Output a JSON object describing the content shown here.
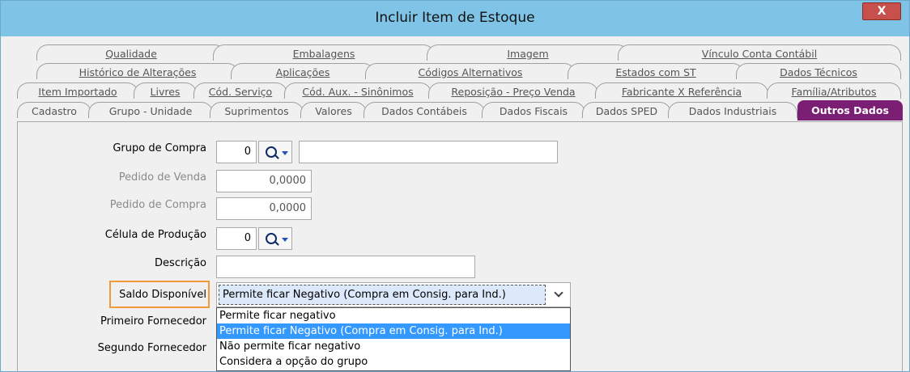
{
  "window": {
    "title": "Incluir Item de Estoque",
    "close_label": "X"
  },
  "tabs": {
    "row1": [
      "Qualidade",
      "Embalagens",
      "Imagem",
      "Vínculo Conta Contábil"
    ],
    "row2": [
      "Histórico de Alterações",
      "Aplicações",
      "Códigos Alternativos",
      "Estados com ST",
      "Dados Técnicos"
    ],
    "row3": [
      "Item Importado",
      "Livres",
      "Cód. Serviço",
      "Cód. Aux. - Sinônimos",
      "Reposição - Preço Venda",
      "Fabricante X Referência",
      "Família/Atributos"
    ],
    "row4": [
      "Cadastro",
      "Grupo - Unidade",
      "Suprimentos",
      "Valores",
      "Dados Contábeis",
      "Dados Fiscais",
      "Dados SPED",
      "Dados Industriais",
      "Outros Dados"
    ],
    "active": "Outros Dados"
  },
  "form": {
    "grupo_compra": {
      "label": "Grupo de Compra",
      "code": "0",
      "description": ""
    },
    "pedido_venda": {
      "label": "Pedido de Venda",
      "value": "0,0000"
    },
    "pedido_compra": {
      "label": "Pedido de Compra",
      "value": "0,0000"
    },
    "celula_producao": {
      "label": "Célula de Produção",
      "code": "0"
    },
    "descricao": {
      "label": "Descrição",
      "value": ""
    },
    "saldo_disponivel": {
      "label": "Saldo Disponível",
      "selected": "Permite ficar Negativo (Compra em Consig. para Ind.)",
      "options": [
        "Permite ficar negativo",
        "Permite ficar Negativo (Compra em Consig. para Ind.)",
        "Não permite ficar negativo",
        "Considera a opção do grupo"
      ]
    },
    "primeiro_fornecedor": {
      "label": "Primeiro Fornecedor"
    },
    "segundo_fornecedor": {
      "label": "Segundo Fornecedor"
    }
  },
  "colors": {
    "titlebar": "#7fc4e6",
    "active_tab": "#7a1f73",
    "highlight": "#f09a3a",
    "selection": "#3399ff"
  }
}
